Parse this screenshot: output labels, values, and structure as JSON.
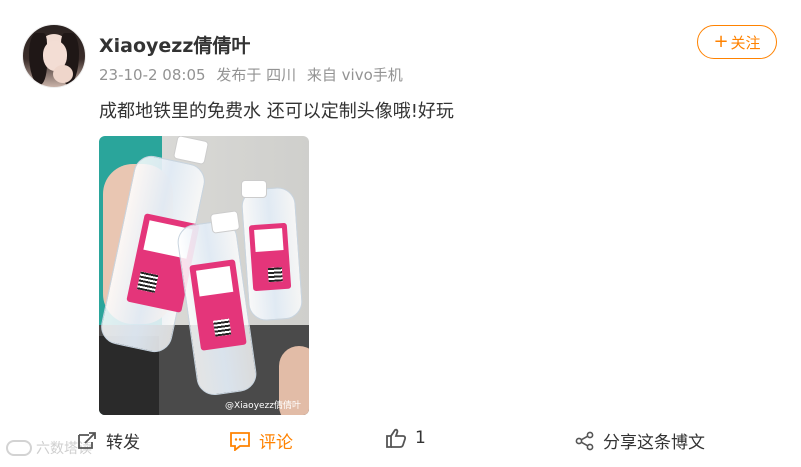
{
  "post": {
    "username": "Xiaoyezz倩倩叶",
    "timestamp": "23-10-2 08:05",
    "location": "发布于 四川",
    "source": "来自 vivo手机",
    "text": "成都地铁里的免费水 还可以定制头像哦!好玩",
    "follow_label": "关注",
    "follow_icon": "plus-icon"
  },
  "actions": {
    "repost_label": "转发",
    "comment_label": "评论",
    "like_count": "1",
    "share_label": "分享这条博文"
  },
  "watermark": {
    "site_text": "六数塔读",
    "photo_watermark": "@Xiaoyezz倩倩叶"
  },
  "colors": {
    "accent": "#ff8200",
    "text": "#333333",
    "meta": "#939393"
  }
}
